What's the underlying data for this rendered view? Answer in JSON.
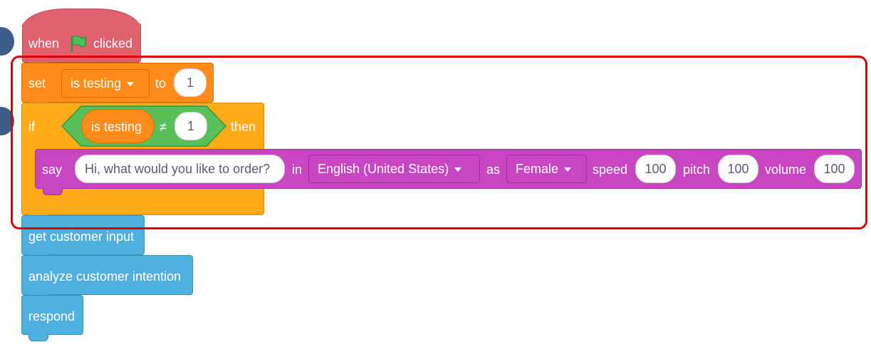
{
  "hat": {
    "when": "when",
    "clicked": "clicked",
    "flag_icon": "green-flag-icon"
  },
  "set_block": {
    "set": "set",
    "variable": "is testing",
    "to": "to",
    "value": "1"
  },
  "if_block": {
    "if": "if",
    "condition": {
      "variable": "is testing",
      "operator": "≠",
      "value": "1"
    },
    "then": "then"
  },
  "say_block": {
    "say": "say",
    "message": "Hi, what would you like to order?",
    "in": "in",
    "language": "English (United States)",
    "as": "as",
    "voice": "Female",
    "speed_label": "speed",
    "speed": "100",
    "pitch_label": "pitch",
    "pitch": "100",
    "volume_label": "volume",
    "volume": "100"
  },
  "custom_blocks": [
    "get customer input",
    "analyze customer intention",
    "respond"
  ],
  "colors": {
    "events": "#e0626f",
    "variables": "#ff8c1a",
    "control": "#ffab19",
    "operators": "#59c059",
    "text_to_speech": "#c846c2",
    "my_blocks": "#4fb0e0",
    "highlight": "#e00000"
  }
}
